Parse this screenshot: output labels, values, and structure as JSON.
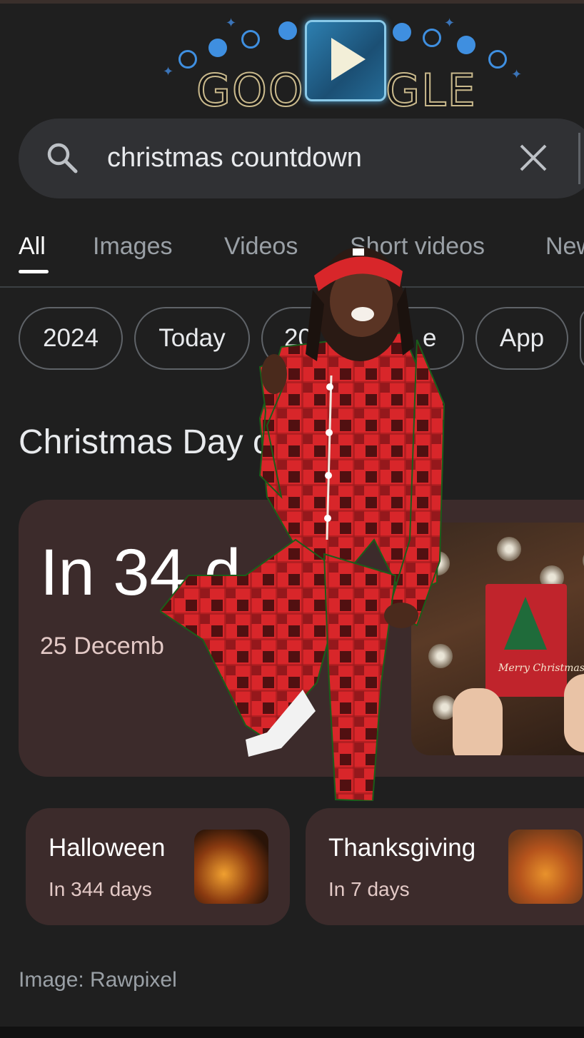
{
  "doodle": {
    "left_text": "GOO",
    "right_text": "GLE",
    "play_icon": "play-icon"
  },
  "search": {
    "query": "christmas countdown",
    "icons": [
      "search-icon",
      "close-icon"
    ]
  },
  "tabs": [
    {
      "label": "All",
      "active": true
    },
    {
      "label": "Images",
      "active": false
    },
    {
      "label": "Videos",
      "active": false
    },
    {
      "label": "Short videos",
      "active": false
    },
    {
      "label": "New",
      "active": false
    }
  ],
  "chips": [
    "2024",
    "Today",
    "20",
    "e",
    "App"
  ],
  "result": {
    "heading": "Christmas Day countdown",
    "countdown": "In 34 d",
    "date": "25 Decemb",
    "card_text": "Merry Christmas"
  },
  "related": [
    {
      "title": "Halloween",
      "subtitle": "In 344 days"
    },
    {
      "title": "Thanksgiving",
      "subtitle": "In 7 days"
    }
  ],
  "credit": "Image: Rawpixel",
  "colors": {
    "background": "#1f1f1f",
    "card": "#3c2b2b",
    "search": "#303134",
    "accent_pajama": "#d8262a"
  }
}
